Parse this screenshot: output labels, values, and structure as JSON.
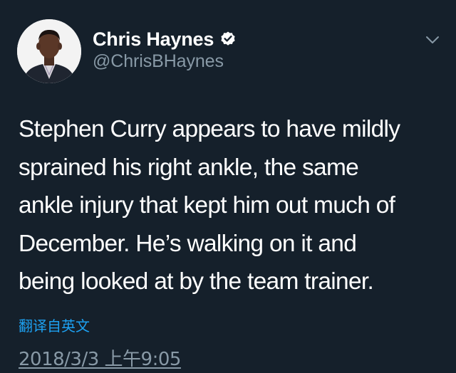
{
  "tweet": {
    "author": {
      "name": "Chris Haynes",
      "handle": "@ChrisBHaynes",
      "verified": true,
      "avatar_icon": "profile-photo"
    },
    "text": "Stephen Curry appears to have mildly\nsprained his right ankle, the same\nankle injury that kept him out much of\nDecember. He’s walking on it and\nbeing looked at by the team trainer.",
    "translate_label": "翻译自英文",
    "timestamp": "2018/3/3 上午9:05",
    "menu_icon": "chevron-down-icon"
  },
  "colors": {
    "background": "#15202b",
    "primary_text": "#ffffff",
    "secondary_text": "#8899a6",
    "link": "#1da1f2",
    "verified_badge": "#ffffff"
  }
}
